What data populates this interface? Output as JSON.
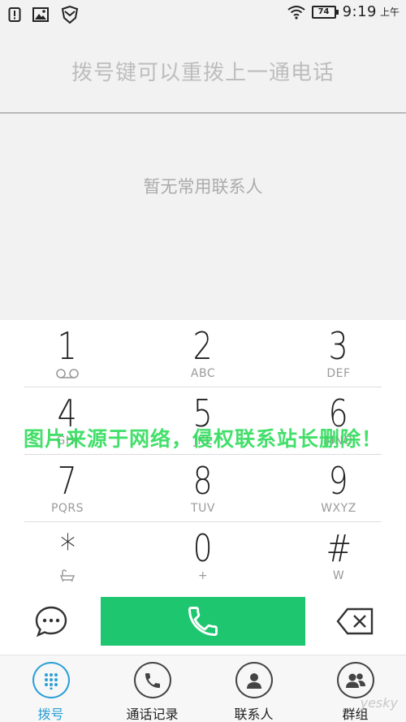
{
  "status_bar": {
    "icons": [
      "alert-icon",
      "image-icon",
      "shield-icon",
      "wifi-icon",
      "battery-icon"
    ],
    "battery": "74",
    "time": "9:19",
    "ampm": "上午"
  },
  "redial_hint": "拨号键可以重拨上一通电话",
  "favorites_empty": "暂无常用联系人",
  "keypad": {
    "keys": [
      {
        "digit": "1",
        "letters": ""
      },
      {
        "digit": "2",
        "letters": "ABC"
      },
      {
        "digit": "3",
        "letters": "DEF"
      },
      {
        "digit": "4",
        "letters": "GHI"
      },
      {
        "digit": "5",
        "letters": "JKL"
      },
      {
        "digit": "6",
        "letters": "MNO"
      },
      {
        "digit": "7",
        "letters": "PQRS"
      },
      {
        "digit": "8",
        "letters": "TUV"
      },
      {
        "digit": "9",
        "letters": "WXYZ"
      },
      {
        "digit": "*",
        "letters": ""
      },
      {
        "digit": "0",
        "letters": "+"
      },
      {
        "digit": "#",
        "letters": "W"
      }
    ]
  },
  "actions": {
    "message_icon": "message-icon",
    "call_icon": "phone-icon",
    "delete_icon": "backspace-icon",
    "call_color": "#1ec66f"
  },
  "bottom_nav": {
    "items": [
      {
        "label": "拨号",
        "icon": "dialpad-icon",
        "active": true
      },
      {
        "label": "通话记录",
        "icon": "phone-icon",
        "active": false
      },
      {
        "label": "联系人",
        "icon": "person-icon",
        "active": false
      },
      {
        "label": "群组",
        "icon": "group-icon",
        "active": false
      }
    ],
    "active_color": "#2a9fd6"
  },
  "watermark": "图片来源于网络，侵权联系站长删除！",
  "corner_mark": "yesky"
}
